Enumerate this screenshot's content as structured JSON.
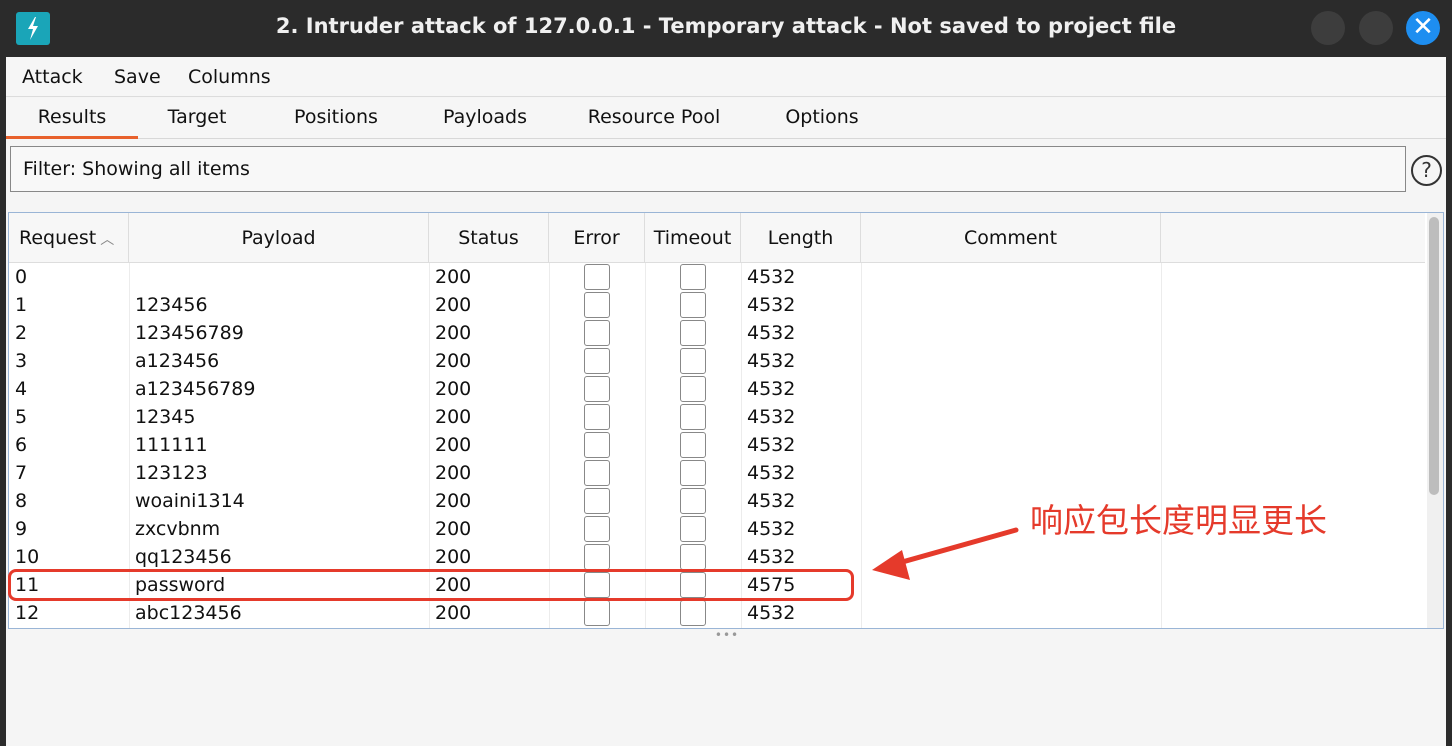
{
  "window": {
    "title": "2. Intruder attack of 127.0.0.1 - Temporary attack - Not saved to project file",
    "close_glyph": "✕"
  },
  "menu": [
    "Attack",
    "Save",
    "Columns"
  ],
  "tabs": [
    {
      "label": "Results",
      "active": true
    },
    {
      "label": "Target",
      "active": false
    },
    {
      "label": "Positions",
      "active": false
    },
    {
      "label": "Payloads",
      "active": false
    },
    {
      "label": "Resource Pool",
      "active": false
    },
    {
      "label": "Options",
      "active": false
    }
  ],
  "filter": {
    "text": "Filter: Showing all items",
    "help_glyph": "?"
  },
  "table": {
    "columns": [
      "Request",
      "Payload",
      "Status",
      "Error",
      "Timeout",
      "Length",
      "Comment"
    ],
    "sort_glyph": "︿",
    "rows": [
      {
        "request": "0",
        "payload": "",
        "status": "200",
        "length": "4532"
      },
      {
        "request": "1",
        "payload": "123456",
        "status": "200",
        "length": "4532"
      },
      {
        "request": "2",
        "payload": "123456789",
        "status": "200",
        "length": "4532"
      },
      {
        "request": "3",
        "payload": "a123456",
        "status": "200",
        "length": "4532"
      },
      {
        "request": "4",
        "payload": "a123456789",
        "status": "200",
        "length": "4532"
      },
      {
        "request": "5",
        "payload": "12345",
        "status": "200",
        "length": "4532"
      },
      {
        "request": "6",
        "payload": "111111",
        "status": "200",
        "length": "4532"
      },
      {
        "request": "7",
        "payload": "123123",
        "status": "200",
        "length": "4532"
      },
      {
        "request": "8",
        "payload": "woaini1314",
        "status": "200",
        "length": "4532"
      },
      {
        "request": "9",
        "payload": "zxcvbnm",
        "status": "200",
        "length": "4532"
      },
      {
        "request": "10",
        "payload": "qq123456",
        "status": "200",
        "length": "4532"
      },
      {
        "request": "11",
        "payload": "password",
        "status": "200",
        "length": "4575"
      },
      {
        "request": "12",
        "payload": "abc123456",
        "status": "200",
        "length": "4532"
      }
    ]
  },
  "splitter_glyph": "•••",
  "annotation": {
    "text": "响应包长度明显更长",
    "color": "#e53a2b"
  },
  "colors": {
    "accent_tab": "#e8612c",
    "title_bar": "#2b2b2b",
    "close_button": "#1e8ef0",
    "app_icon": "#1aa5b8"
  }
}
